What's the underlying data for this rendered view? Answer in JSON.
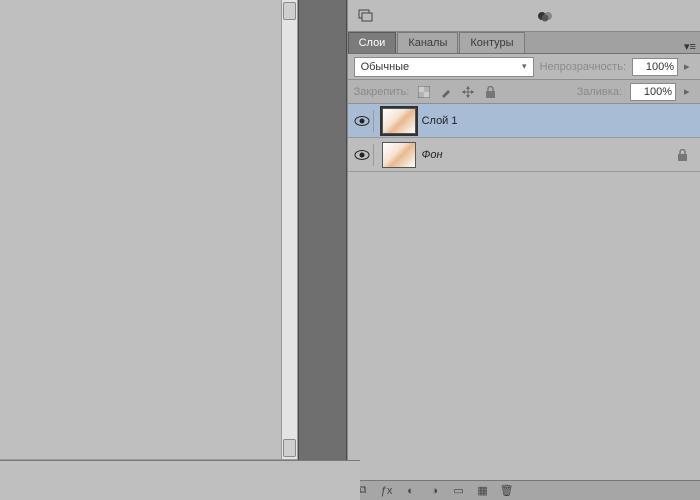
{
  "tabs": {
    "layers": "Слои",
    "channels": "Каналы",
    "paths": "Контуры"
  },
  "blend_mode": {
    "selected": "Обычные"
  },
  "opacity": {
    "label": "Непрозрачность:",
    "value": "100%"
  },
  "lock": {
    "label": "Закрепить:"
  },
  "fill": {
    "label": "Заливка:",
    "value": "100%"
  },
  "layers": [
    {
      "name": "Слой 1",
      "selected": true,
      "locked": false,
      "italic": false
    },
    {
      "name": "Фон",
      "selected": false,
      "locked": true,
      "italic": true
    }
  ]
}
